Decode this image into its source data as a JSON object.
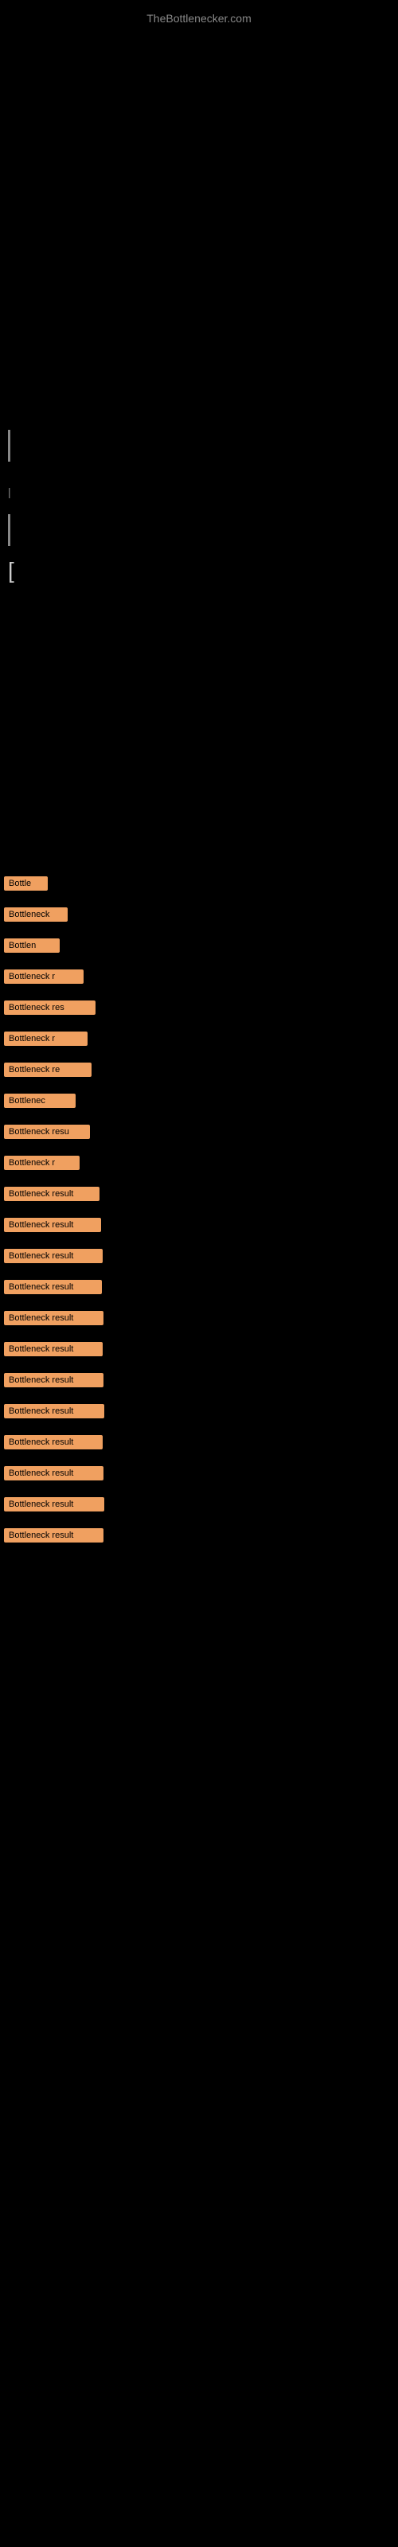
{
  "site": {
    "title": "TheBottlenecker.com"
  },
  "header": {
    "line1": "|",
    "bracket": "["
  },
  "bottleneck_items": [
    {
      "id": 1,
      "label": "Bottle",
      "width_class": "bw-1"
    },
    {
      "id": 2,
      "label": "Bottleneck",
      "width_class": "bw-2"
    },
    {
      "id": 3,
      "label": "Bottlen",
      "width_class": "bw-3"
    },
    {
      "id": 4,
      "label": "Bottleneck r",
      "width_class": "bw-4"
    },
    {
      "id": 5,
      "label": "Bottleneck res",
      "width_class": "bw-5"
    },
    {
      "id": 6,
      "label": "Bottleneck r",
      "width_class": "bw-6"
    },
    {
      "id": 7,
      "label": "Bottleneck re",
      "width_class": "bw-7"
    },
    {
      "id": 8,
      "label": "Bottlenec",
      "width_class": "bw-8"
    },
    {
      "id": 9,
      "label": "Bottleneck resu",
      "width_class": "bw-9"
    },
    {
      "id": 10,
      "label": "Bottleneck r",
      "width_class": "bw-10"
    },
    {
      "id": 11,
      "label": "Bottleneck result",
      "width_class": "bw-11"
    },
    {
      "id": 12,
      "label": "Bottleneck result",
      "width_class": "bw-12"
    },
    {
      "id": 13,
      "label": "Bottleneck result",
      "width_class": "bw-13"
    },
    {
      "id": 14,
      "label": "Bottleneck result",
      "width_class": "bw-14"
    },
    {
      "id": 15,
      "label": "Bottleneck result",
      "width_class": "bw-15"
    },
    {
      "id": 16,
      "label": "Bottleneck result",
      "width_class": "bw-16"
    },
    {
      "id": 17,
      "label": "Bottleneck result",
      "width_class": "bw-17"
    },
    {
      "id": 18,
      "label": "Bottleneck result",
      "width_class": "bw-18"
    },
    {
      "id": 19,
      "label": "Bottleneck result",
      "width_class": "bw-19"
    },
    {
      "id": 20,
      "label": "Bottleneck result",
      "width_class": "bw-20"
    },
    {
      "id": 21,
      "label": "Bottleneck result",
      "width_class": "bw-21"
    },
    {
      "id": 22,
      "label": "Bottleneck result",
      "width_class": "bw-22"
    }
  ]
}
